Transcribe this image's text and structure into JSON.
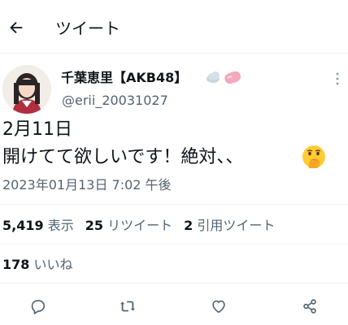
{
  "header": {
    "back_icon": "arrow-left-icon",
    "title": "ツイート"
  },
  "author": {
    "display_name": "千葉恵里【AKB48】",
    "name_emojis": [
      "cloud-emoji",
      "pink-candy-emoji"
    ],
    "handle": "@erii_20031027"
  },
  "tweet": {
    "line1": "2月11日",
    "line2": "開けてて欲しいです！絶対、、",
    "trailing_emoji": "face-with-hand-over-mouth-emoji",
    "timestamp": "2023年01月13日 7:02 午後"
  },
  "stats": {
    "views_count": "5,419",
    "views_label": "表示",
    "retweets_count": "25",
    "retweets_label": "リツイート",
    "quotes_count": "2",
    "quotes_label": "引用ツイート",
    "likes_count": "178",
    "likes_label": "いいね"
  },
  "actions": [
    "reply-icon",
    "retweet-icon",
    "like-icon",
    "share-icon"
  ],
  "colors": {
    "text": "#0f1419",
    "secondary_text": "#536471",
    "divider": "#eff3f4"
  }
}
